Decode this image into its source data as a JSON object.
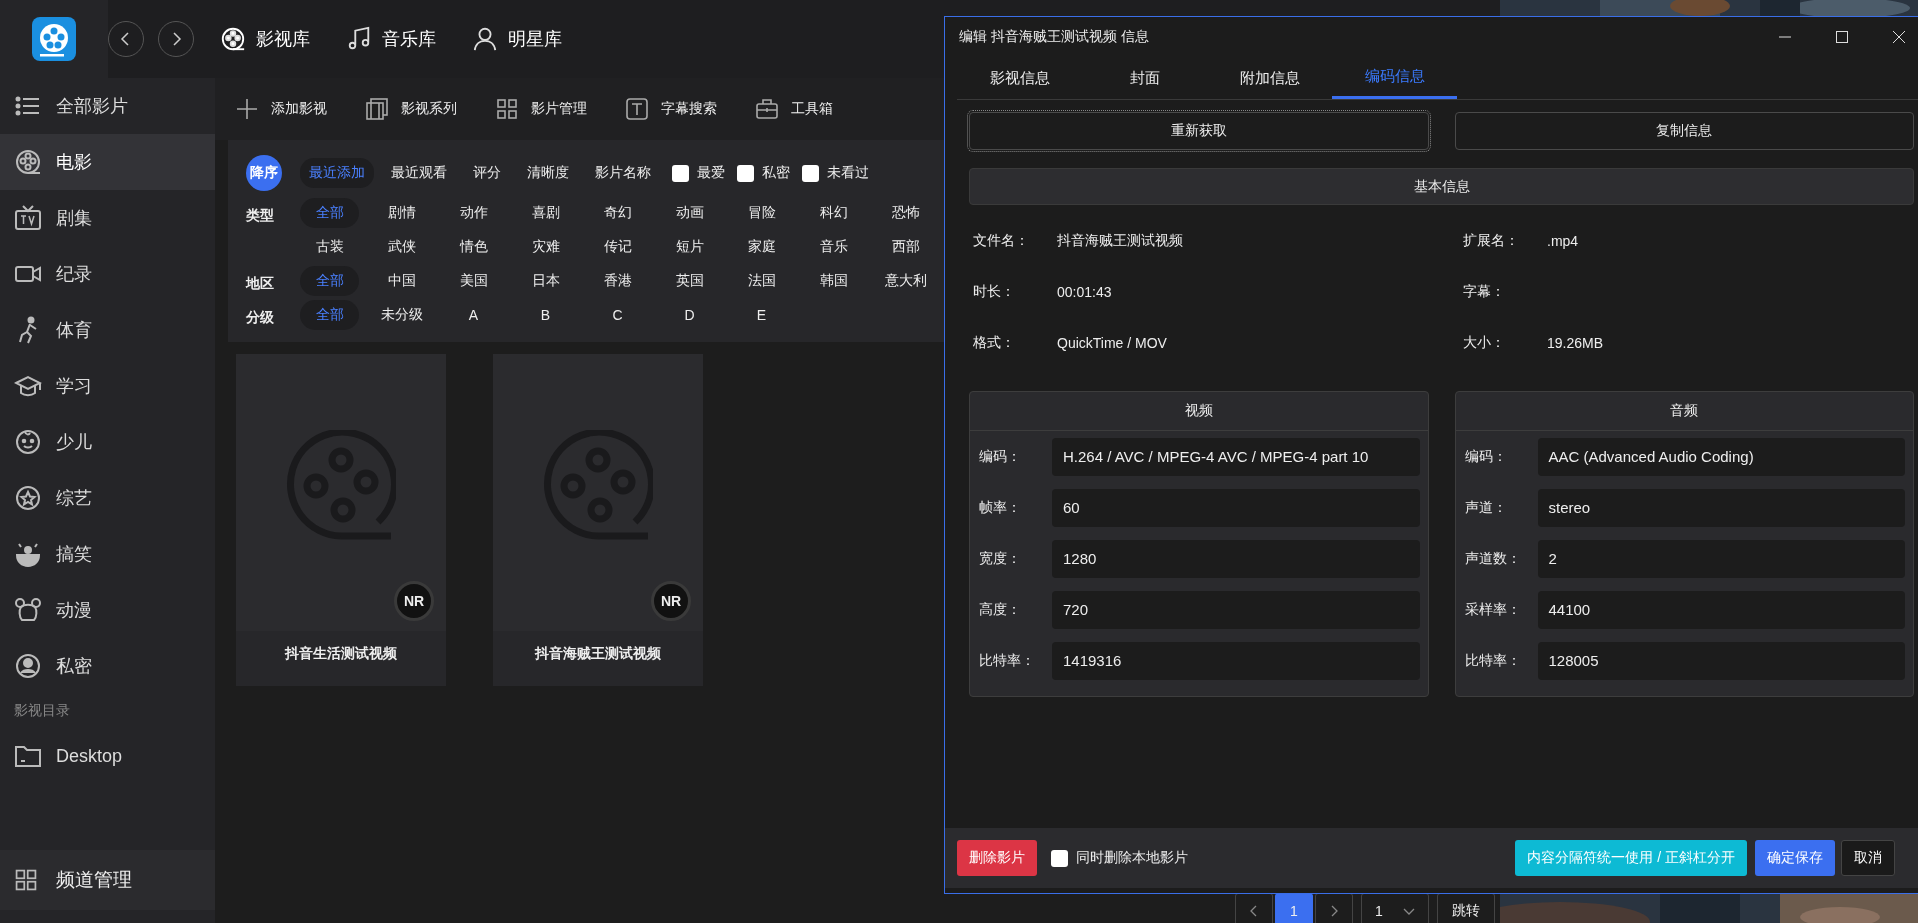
{
  "top_nav": [
    {
      "label": "影视库"
    },
    {
      "label": "音乐库"
    },
    {
      "label": "明星库"
    }
  ],
  "sidebar": {
    "items": [
      {
        "label": "全部影片",
        "selected": false
      },
      {
        "label": "电影",
        "selected": true
      },
      {
        "label": "剧集",
        "selected": false
      },
      {
        "label": "纪录",
        "selected": false
      },
      {
        "label": "体育",
        "selected": false
      },
      {
        "label": "学习",
        "selected": false
      },
      {
        "label": "少儿",
        "selected": false
      },
      {
        "label": "综艺",
        "selected": false
      },
      {
        "label": "搞笑",
        "selected": false
      },
      {
        "label": "动漫",
        "selected": false
      },
      {
        "label": "私密",
        "selected": false
      }
    ],
    "section_title": "影视目录",
    "folders": [
      {
        "label": "Desktop"
      }
    ],
    "footer_item": "频道管理"
  },
  "toolbar": [
    "添加影视",
    "影视系列",
    "影片管理",
    "字幕搜索",
    "工具箱"
  ],
  "sort": {
    "direction": "降序",
    "options": [
      {
        "label": "最近添加",
        "selected": true
      },
      {
        "label": "最近观看",
        "selected": false
      },
      {
        "label": "评分",
        "selected": false
      },
      {
        "label": "清晰度",
        "selected": false
      },
      {
        "label": "影片名称",
        "selected": false
      }
    ],
    "checkboxes": [
      {
        "label": "最爱",
        "checked": false
      },
      {
        "label": "私密",
        "checked": false
      },
      {
        "label": "未看过",
        "checked": false
      }
    ]
  },
  "filters": [
    {
      "label": "类型",
      "options": [
        {
          "label": "全部",
          "selected": true
        },
        {
          "label": "剧情",
          "selected": false
        },
        {
          "label": "动作",
          "selected": false
        },
        {
          "label": "喜剧",
          "selected": false
        },
        {
          "label": "奇幻",
          "selected": false
        },
        {
          "label": "动画",
          "selected": false
        },
        {
          "label": "冒险",
          "selected": false
        },
        {
          "label": "科幻",
          "selected": false
        },
        {
          "label": "恐怖",
          "selected": false
        },
        {
          "label": "古装",
          "selected": false
        },
        {
          "label": "武侠",
          "selected": false
        },
        {
          "label": "情色",
          "selected": false
        },
        {
          "label": "灾难",
          "selected": false
        },
        {
          "label": "传记",
          "selected": false
        },
        {
          "label": "短片",
          "selected": false
        },
        {
          "label": "家庭",
          "selected": false
        },
        {
          "label": "音乐",
          "selected": false
        },
        {
          "label": "西部",
          "selected": false
        }
      ]
    },
    {
      "label": "地区",
      "options": [
        {
          "label": "全部",
          "selected": true
        },
        {
          "label": "中国",
          "selected": false
        },
        {
          "label": "美国",
          "selected": false
        },
        {
          "label": "日本",
          "selected": false
        },
        {
          "label": "香港",
          "selected": false
        },
        {
          "label": "英国",
          "selected": false
        },
        {
          "label": "法国",
          "selected": false
        },
        {
          "label": "韩国",
          "selected": false
        },
        {
          "label": "意大利",
          "selected": false
        }
      ]
    },
    {
      "label": "分级",
      "options": [
        {
          "label": "全部",
          "selected": true
        },
        {
          "label": "未分级",
          "selected": false
        },
        {
          "label": "A",
          "selected": false
        },
        {
          "label": "B",
          "selected": false
        },
        {
          "label": "C",
          "selected": false
        },
        {
          "label": "D",
          "selected": false
        },
        {
          "label": "E",
          "selected": false
        }
      ]
    }
  ],
  "cards": [
    {
      "title": "抖音生活测试视频",
      "rating": "NR"
    },
    {
      "title": "抖音海贼王测试视频",
      "rating": "NR"
    }
  ],
  "pagination": {
    "pages": [
      {
        "label": "1",
        "selected": true
      }
    ],
    "page_size": "1",
    "jump": "跳转"
  },
  "dialog": {
    "title": "编辑 抖音海贼王测试视频 信息",
    "tabs": [
      {
        "label": "影视信息",
        "selected": false
      },
      {
        "label": "封面",
        "selected": false
      },
      {
        "label": "附加信息",
        "selected": false
      },
      {
        "label": "编码信息",
        "selected": true
      }
    ],
    "actions": [
      "重新获取",
      "复制信息"
    ],
    "basic_title": "基本信息",
    "basic_fields": [
      {
        "label": "文件名：",
        "value": "抖音海贼王测试视频"
      },
      {
        "label": "扩展名：",
        "value": ".mp4"
      },
      {
        "label": "时长：",
        "value": "00:01:43"
      },
      {
        "label": "字幕："
      },
      {
        "label": "格式：",
        "value": "QuickTime / MOV"
      },
      {
        "label": "大小：",
        "value": "19.26MB"
      }
    ],
    "panels": [
      {
        "title": "视频",
        "fields": [
          {
            "label": "编码：",
            "value": "H.264 / AVC / MPEG-4 AVC / MPEG-4 part 10"
          },
          {
            "label": "帧率：",
            "value": "60"
          },
          {
            "label": "宽度：",
            "value": "1280"
          },
          {
            "label": "高度：",
            "value": "720"
          },
          {
            "label": "比特率：",
            "value": "1419316"
          }
        ]
      },
      {
        "title": "音频",
        "fields": [
          {
            "label": "编码：",
            "value": "AAC (Advanced Audio Coding)"
          },
          {
            "label": "声道：",
            "value": "stereo"
          },
          {
            "label": "声道数：",
            "value": "2"
          },
          {
            "label": "采样率：",
            "value": "44100"
          },
          {
            "label": "比特率：",
            "value": "128005"
          }
        ]
      }
    ],
    "footer": {
      "delete": "删除影片",
      "delete_local": {
        "label": "同时删除本地影片",
        "checked": false
      },
      "separator_button": "内容分隔符统一使用 / 正斜杠分开",
      "save": "确定保存",
      "cancel": "取消"
    }
  }
}
